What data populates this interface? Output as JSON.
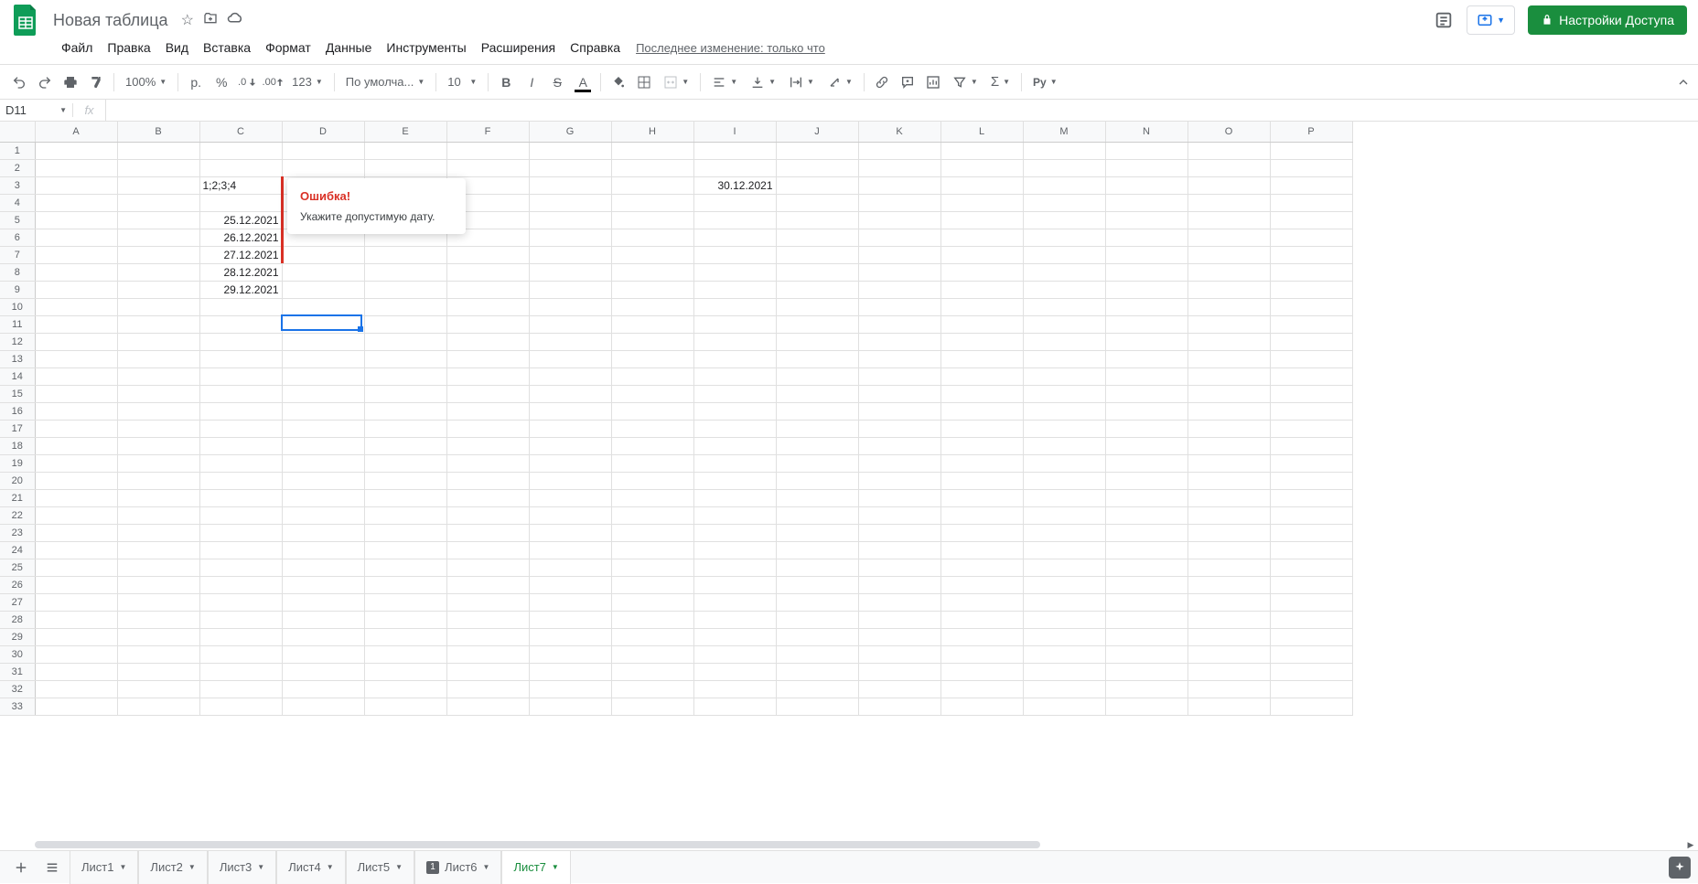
{
  "header": {
    "doc_title": "Новая таблица",
    "share_label": "Настройки Доступа"
  },
  "menubar": {
    "items": [
      "Файл",
      "Правка",
      "Вид",
      "Вставка",
      "Формат",
      "Данные",
      "Инструменты",
      "Расширения",
      "Справка"
    ],
    "last_edit": "Последнее изменение: только что"
  },
  "toolbar": {
    "zoom": "100%",
    "currency": "р.",
    "percent": "%",
    "dec_dec": ".0",
    "inc_dec": ".00",
    "num_fmt": "123",
    "font": "По умолча...",
    "font_size": "10"
  },
  "name_box": "D11",
  "formula": "",
  "columns": [
    "A",
    "B",
    "C",
    "D",
    "E",
    "F",
    "G",
    "H",
    "I",
    "J",
    "K",
    "L",
    "M",
    "N",
    "O",
    "P"
  ],
  "row_count": 33,
  "cells": {
    "C3": {
      "v": "1;2;3;4",
      "align": "left"
    },
    "I3": {
      "v": "30.12.2021",
      "align": "right"
    },
    "C5": {
      "v": "25.12.2021",
      "align": "right"
    },
    "C6": {
      "v": "26.12.2021",
      "align": "right"
    },
    "C7": {
      "v": "27.12.2021",
      "align": "right"
    },
    "C8": {
      "v": "28.12.2021",
      "align": "right"
    },
    "C9": {
      "v": "29.12.2021",
      "align": "right"
    }
  },
  "active_cell": "D11",
  "validation": {
    "cell": "D3",
    "rows": [
      3,
      4,
      5,
      6,
      7
    ],
    "title": "Ошибка!",
    "message": "Укажите допустимую дату."
  },
  "tabs": [
    {
      "label": "Лист1",
      "active": false
    },
    {
      "label": "Лист2",
      "active": false
    },
    {
      "label": "Лист3",
      "active": false
    },
    {
      "label": "Лист4",
      "active": false
    },
    {
      "label": "Лист5",
      "active": false
    },
    {
      "label": "Лист6",
      "active": false,
      "badge": "1"
    },
    {
      "label": "Лист7",
      "active": true
    }
  ]
}
